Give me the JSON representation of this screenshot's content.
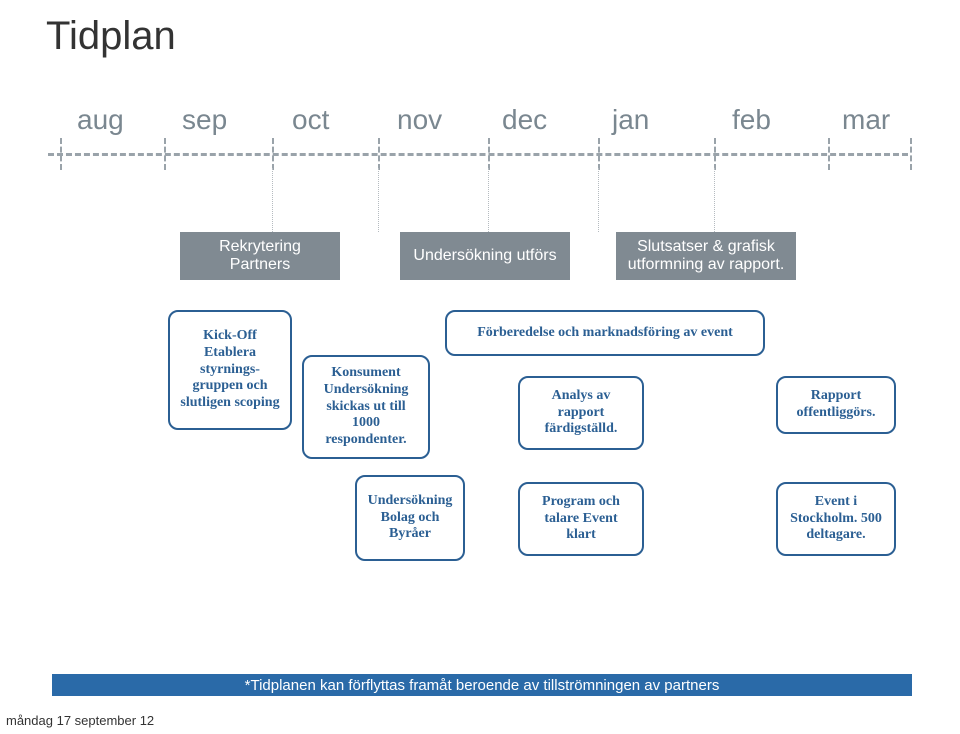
{
  "title": "Tidplan",
  "months": [
    "aug",
    "sep",
    "oct",
    "nov",
    "dec",
    "jan",
    "feb",
    "mar"
  ],
  "grey": {
    "recruiting": "Rekrytering\nPartners",
    "survey": "Undersökning utförs",
    "conclusions": "Slutsatser & grafisk utformning av rapport."
  },
  "blue": {
    "kickoff": "Kick-Off Etablera styrnings-gruppen och slutligen scoping",
    "consumer": "Konsument Undersökning skickas ut till 1000 respondenter.",
    "agencies": "Undersökning Bolag och Byråer",
    "prep": "Förberedelse och marknadsföring av event",
    "analysis": "Analys av rapport färdigställd.",
    "program": "Program och talare Event klart",
    "report": "Rapport offentliggörs.",
    "event": "Event i Stockholm. 500 deltagare."
  },
  "footnote": "*Tidplanen kan förflyttas framåt beroende av tillströmningen av partners",
  "footer_date": "måndag 17 september 12"
}
